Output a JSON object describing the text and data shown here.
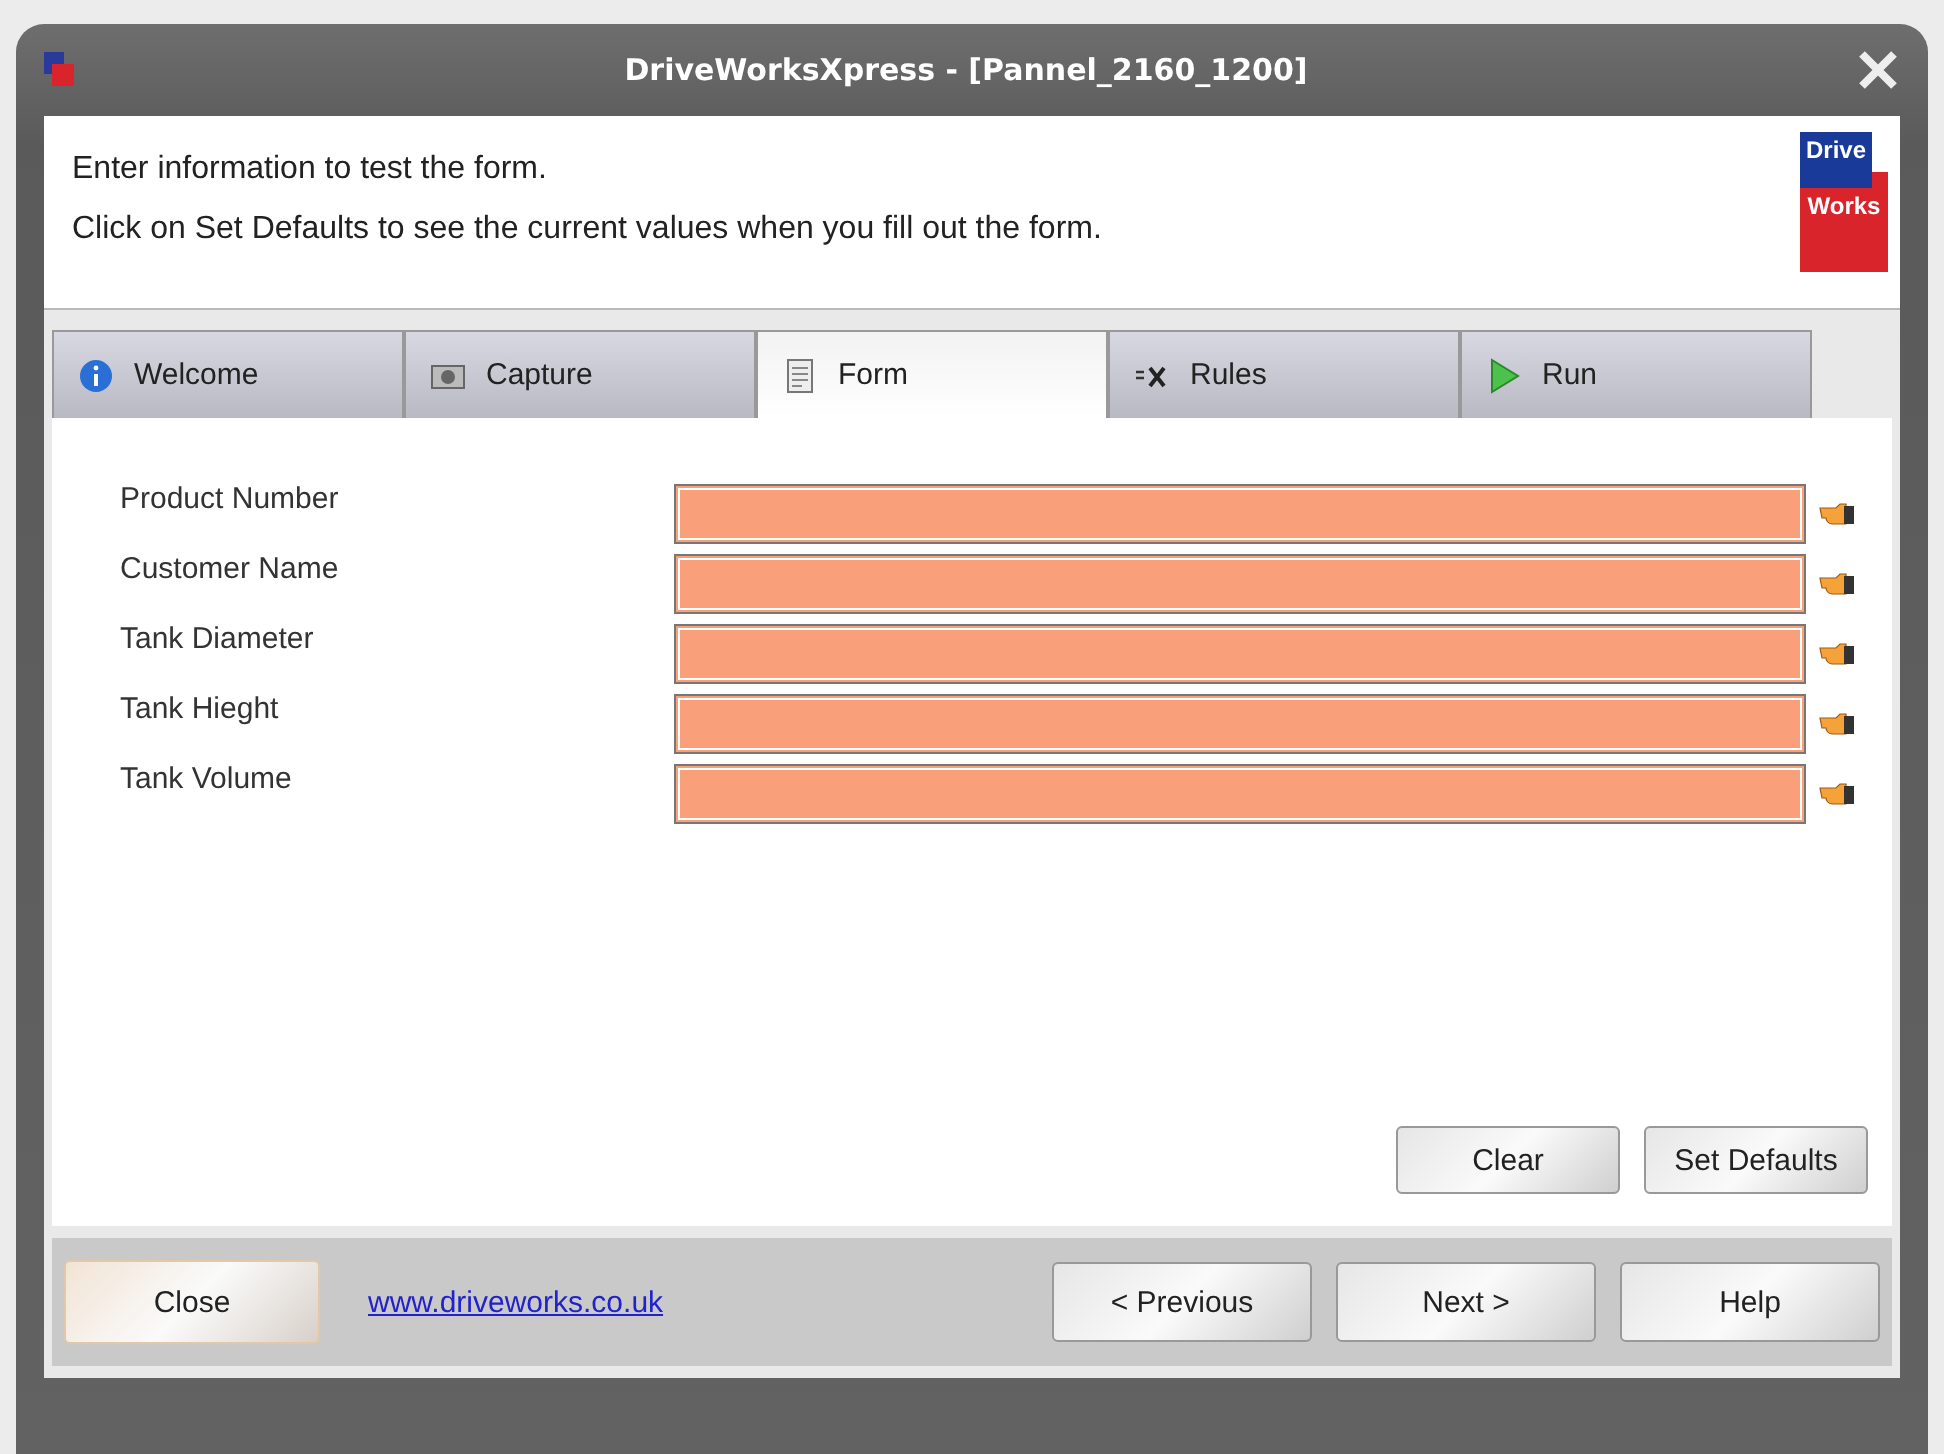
{
  "window": {
    "title": "DriveWorksXpress - [Pannel_2160_1200]"
  },
  "header": {
    "lines": [
      "Enter information to test the form.",
      "Click on Set Defaults to see the current values when you fill out the form."
    ],
    "logo": [
      "Drive",
      "Works"
    ]
  },
  "tabs": [
    {
      "label": "Welcome",
      "kind": "info",
      "selected": false
    },
    {
      "label": "Capture",
      "kind": "camera",
      "selected": false
    },
    {
      "label": "Form",
      "kind": "form",
      "selected": true
    },
    {
      "label": "Rules",
      "kind": "formula",
      "selected": false
    },
    {
      "label": "Run",
      "kind": "play",
      "selected": false
    }
  ],
  "fields": [
    {
      "label": "Product Number"
    },
    {
      "label": "Customer Name"
    },
    {
      "label": "Tank Diameter"
    },
    {
      "label": "Tank Hieght"
    },
    {
      "label": "Tank Volume"
    }
  ],
  "form_buttons": [
    "Clear",
    "Set Defaults"
  ],
  "footer": {
    "close": "Close",
    "link": "www.driveworks.co.uk",
    "buttons": [
      "< Previous",
      "Next >",
      "Help"
    ]
  }
}
